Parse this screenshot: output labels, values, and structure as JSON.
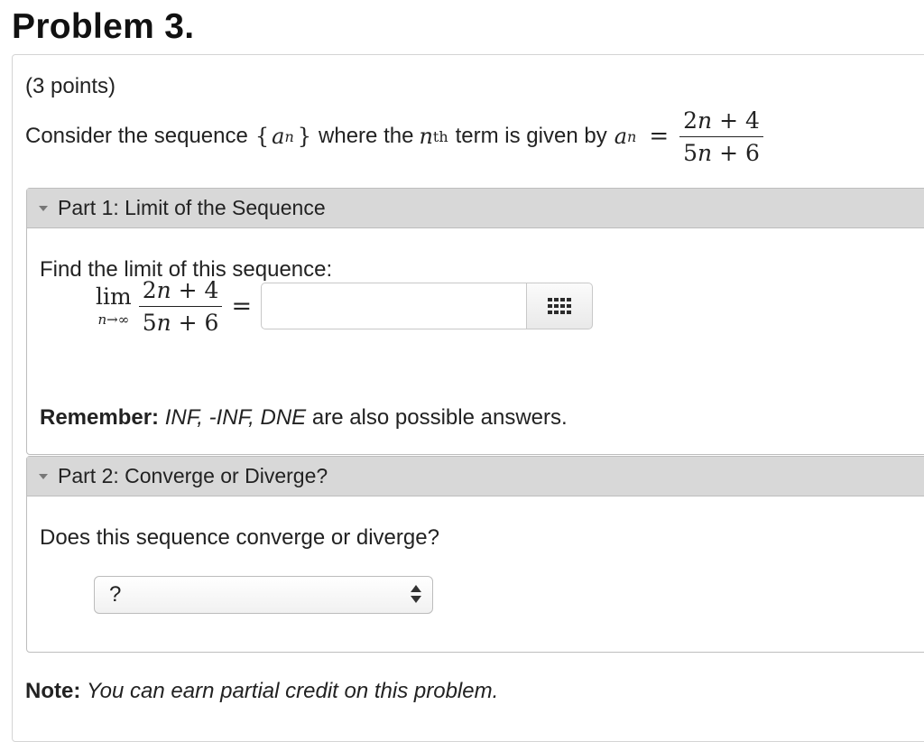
{
  "problem": {
    "title": "Problem 3.",
    "points": "(3 points)",
    "statement": {
      "prefix": "Consider the sequence",
      "seq_open": "{",
      "seq_var": "a",
      "seq_sub": "n",
      "seq_close": "}",
      "middle": "where the",
      "nth_var": "n",
      "nth_sup": "th",
      "suffix": "term is given by",
      "an_var": "a",
      "an_sub": "n",
      "equals": "=",
      "numerator_coef": "2",
      "numerator_var": "n",
      "numerator_rest": " + 4",
      "denominator_coef": "5",
      "denominator_var": "n",
      "denominator_rest": " + 6"
    }
  },
  "part1": {
    "header": "Part 1: Limit of the Sequence",
    "prompt": "Find the limit of this sequence:",
    "lim_word": "lim",
    "lim_sub": "n→∞",
    "numerator_coef": "2",
    "numerator_var": "n",
    "numerator_rest": " + 4",
    "denominator_coef": "5",
    "denominator_var": "n",
    "denominator_rest": " + 6",
    "equals": "=",
    "answer_value": "",
    "remember_label": "Remember:",
    "remember_options": "INF, -INF, DNE",
    "remember_rest": " are also possible answers."
  },
  "part2": {
    "header": "Part 2: Converge or Diverge?",
    "prompt": "Does this sequence converge or diverge?",
    "select_value": "?"
  },
  "note": {
    "label": "Note:",
    "text": "You can earn partial credit on this problem."
  },
  "icons": {
    "caret": "caret-down-icon",
    "keypad": "keypad-grid-icon",
    "select_arrows": "select-updown-icon"
  }
}
